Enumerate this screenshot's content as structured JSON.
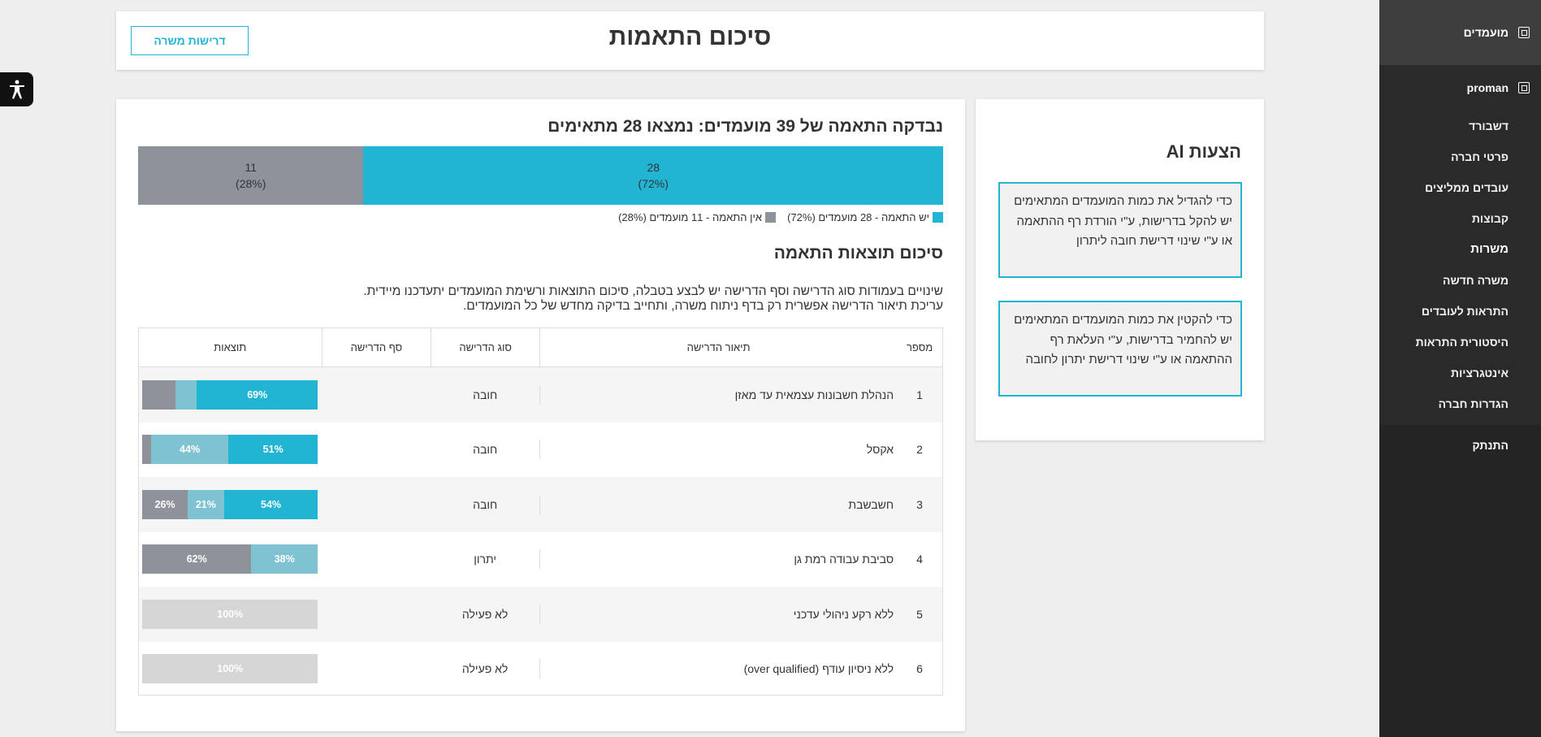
{
  "header": {
    "title": "סיכום התאמות",
    "requirements_button": "דרישות משרה"
  },
  "sidebar": {
    "top_label": "מועמדים",
    "company": "proman",
    "items": [
      {
        "label": "דשבורד"
      },
      {
        "label": "פרטי חברה"
      },
      {
        "label": "עובדים ממליצים"
      },
      {
        "label": "קבוצות"
      },
      {
        "label": "משרות"
      },
      {
        "label": "משרה חדשה"
      },
      {
        "label": "התראות לעובדים"
      },
      {
        "label": "היסטורית התראות"
      },
      {
        "label": "אינטגרציות"
      },
      {
        "label": "הגדרות חברה"
      }
    ],
    "logout": "התנתק"
  },
  "ai": {
    "title": "הצעות AI",
    "tip1": "כדי להגדיל את כמות המועמדים המתאימים יש להקל בדרישות, ע\"י הורדת רף ההתאמה או ע\"י שינוי דרישת חובה ליתרון",
    "tip2": "כדי להקטין את כמות המועמדים המתאימים יש להחמיר בדרישות, ע\"י העלאת רף ההתאמה או ע\"י שינוי דרישת יתרון לחובה"
  },
  "match": {
    "title": "נבדקה התאמה של 39 מועמדים: נמצאו 28 מתאימים",
    "matched": {
      "count": "28",
      "pct": "(72%)",
      "fraction": 0.72,
      "color": "#22b5d3"
    },
    "unmatched": {
      "count": "11",
      "pct": "(28%)",
      "fraction": 0.28,
      "color": "#8e929b"
    },
    "legend_matched": "יש התאמה - 28 מועמדים (72%)",
    "legend_unmatched": "אין התאמה - 11 מועמדים (28%)"
  },
  "summary": {
    "title": "סיכום תוצאות התאמה",
    "line1": "שינויים בעמודות סוג הדרישה וסף הדרישה יש לבצע בטבלה, סיכום התוצאות ורשימת המועמדים יתעדכנו מיידית.",
    "line2": "עריכת תיאור הדרישה אפשרית רק בדף ניתוח משרה, ותחייב בדיקה מחדש של כל המועמדים."
  },
  "table": {
    "headers": {
      "num": "מספר",
      "desc": "תיאור הדרישה",
      "type": "סוג הדרישה",
      "edge": "סף הדרישה",
      "results": "תוצאות"
    },
    "rows": [
      {
        "num": "1",
        "desc": "הנהלת חשבונות עצמאית עד מאזן",
        "type": "חובה",
        "segments": [
          {
            "value": 0.69,
            "label": "69%",
            "color": "#22b5d3"
          },
          {
            "value": 0.12,
            "label": "",
            "color": "#7fc3d3"
          },
          {
            "value": 0.19,
            "label": "",
            "color": "#8e929b"
          }
        ]
      },
      {
        "num": "2",
        "desc": "אקסל",
        "type": "חובה",
        "segments": [
          {
            "value": 0.51,
            "label": "51%",
            "color": "#22b5d3"
          },
          {
            "value": 0.44,
            "label": "44%",
            "color": "#7fc3d3"
          },
          {
            "value": 0.05,
            "label": "",
            "color": "#8e929b"
          }
        ]
      },
      {
        "num": "3",
        "desc": "חשבשבת",
        "type": "חובה",
        "segments": [
          {
            "value": 0.54,
            "label": "54%",
            "color": "#22b5d3"
          },
          {
            "value": 0.21,
            "label": "21%",
            "color": "#7fc3d3"
          },
          {
            "value": 0.26,
            "label": "26%",
            "color": "#8e929b"
          }
        ]
      },
      {
        "num": "4",
        "desc": "סביבת עבודה רמת גן",
        "type": "יתרון",
        "segments": [
          {
            "value": 0.38,
            "label": "38%",
            "color": "#7fc3d3"
          },
          {
            "value": 0.62,
            "label": "62%",
            "color": "#8e929b"
          }
        ]
      },
      {
        "num": "5",
        "desc": "ללא רקע ניהולי עדכני",
        "type": "לא פעילה",
        "segments": [
          {
            "value": 1.0,
            "label": "100%",
            "color": "#d6d6d6"
          }
        ]
      },
      {
        "num": "6",
        "desc": "ללא ניסיון עודף (over qualified)",
        "type": "לא פעילה",
        "segments": [
          {
            "value": 1.0,
            "label": "100%",
            "color": "#d6d6d6"
          }
        ]
      }
    ]
  }
}
